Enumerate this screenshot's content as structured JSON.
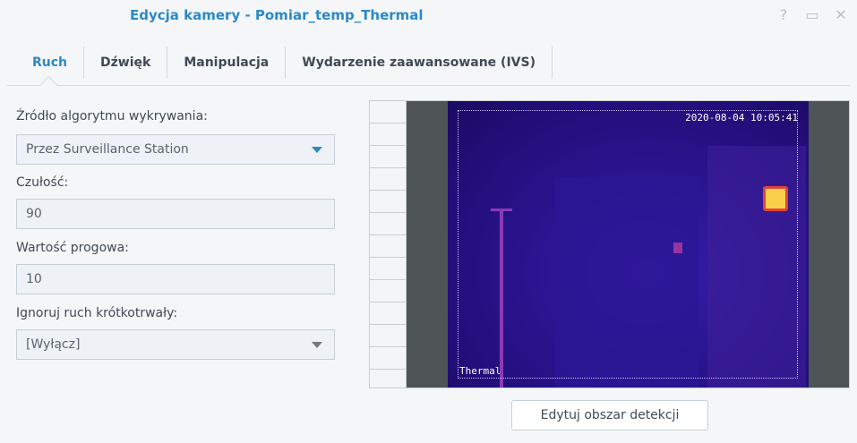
{
  "window": {
    "title": "Edycja kamery - Pomiar_temp_Thermal",
    "controls": {
      "help": "?",
      "maximize": "▭",
      "close": "✕"
    }
  },
  "tabs": [
    {
      "label": "Ruch",
      "active": true
    },
    {
      "label": "Dźwięk"
    },
    {
      "label": "Manipulacja"
    },
    {
      "label": "Wydarzenie zaawansowane (IVS)"
    }
  ],
  "form": {
    "source_label": "Źródło algorytmu wykrywania:",
    "source_value": "Przez Surveillance Station",
    "sensitivity_label": "Czułość:",
    "sensitivity_value": "90",
    "threshold_label": "Wartość progowa:",
    "threshold_value": "10",
    "ignore_label": "Ignoruj ruch krótkotrwały:",
    "ignore_value": "[Wyłącz]"
  },
  "preview": {
    "timestamp": "2020-08-04 10:05:41",
    "camera_name": "Thermal"
  },
  "actions": {
    "edit_detection_area": "Edytuj obszar detekcji"
  },
  "colors": {
    "accent": "#2b8ac8",
    "background": "#f4f6f8"
  }
}
